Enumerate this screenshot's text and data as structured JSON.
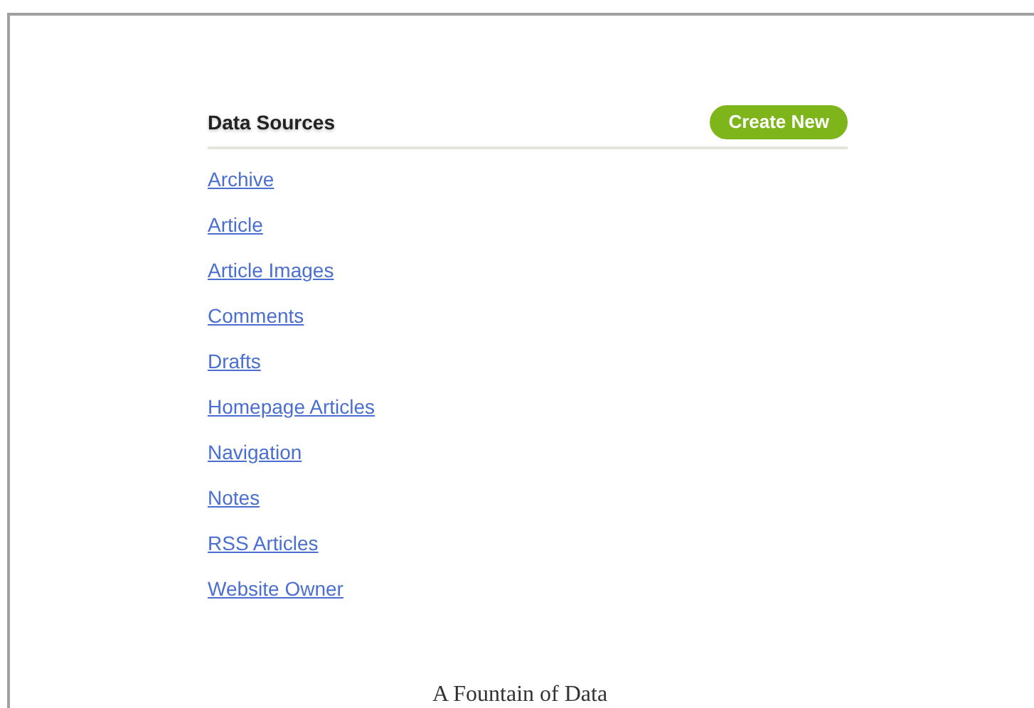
{
  "panel": {
    "title": "Data Sources",
    "button": "Create New"
  },
  "sources": [
    "Archive",
    "Article",
    "Article Images",
    "Comments",
    "Drafts",
    "Homepage Articles",
    "Navigation",
    "Notes",
    "RSS Articles",
    "Website Owner"
  ],
  "caption": "A Fountain of Data"
}
